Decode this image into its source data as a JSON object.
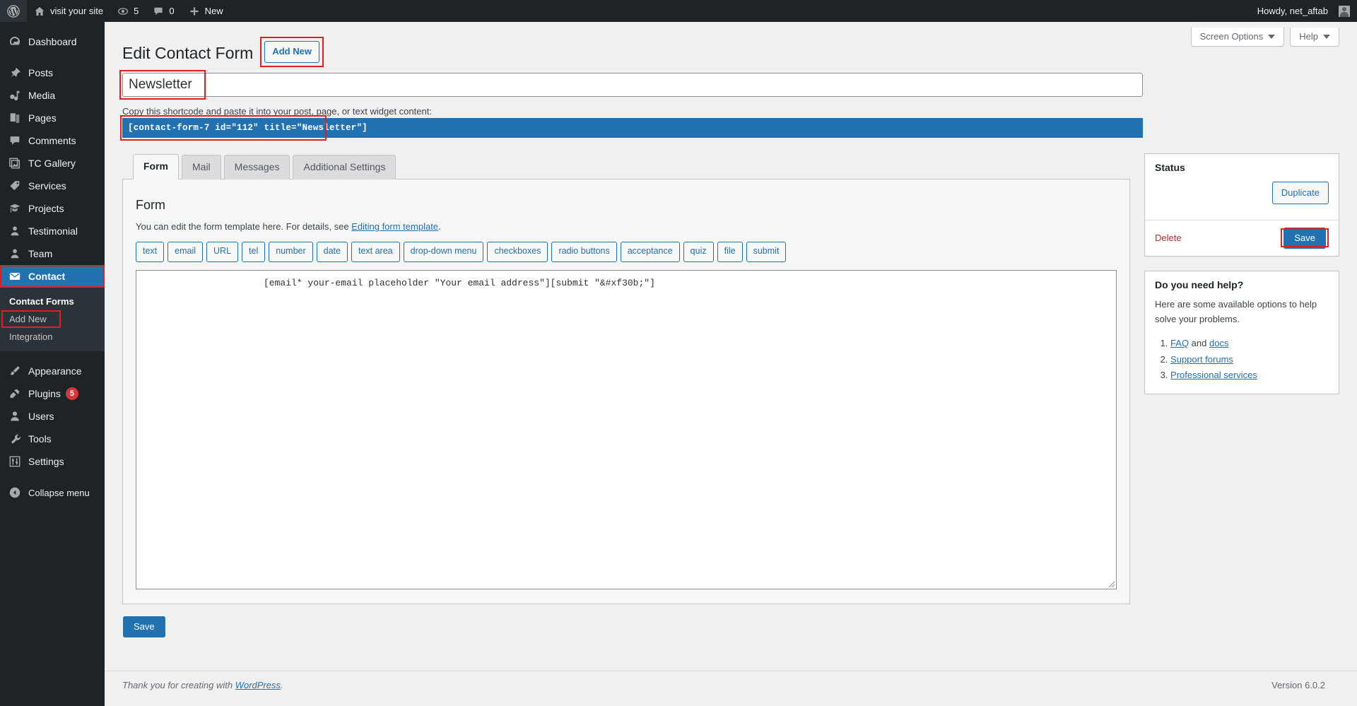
{
  "adminbar": {
    "logo_icon": "wordpress-logo-icon",
    "left_items": [
      {
        "label": "visit your site",
        "icon": "home-icon"
      },
      {
        "label": "5",
        "icon": "updates-icon"
      },
      {
        "label": "0",
        "icon": "comment-icon"
      },
      {
        "label": "New",
        "icon": "plus-icon"
      }
    ],
    "howdy": "Howdy, net_aftab"
  },
  "sidebar": {
    "items": [
      {
        "label": "Dashboard",
        "icon": "dashboard-icon"
      },
      {
        "label": "Posts",
        "icon": "pin-icon"
      },
      {
        "label": "Media",
        "icon": "media-icon"
      },
      {
        "label": "Pages",
        "icon": "pages-icon"
      },
      {
        "label": "Comments",
        "icon": "comment-icon"
      },
      {
        "label": "TC Gallery",
        "icon": "gallery-icon"
      },
      {
        "label": "Services",
        "icon": "tag-icon"
      },
      {
        "label": "Projects",
        "icon": "graduation-cap-icon"
      },
      {
        "label": "Testimonial",
        "icon": "user-icon"
      },
      {
        "label": "Team",
        "icon": "user-icon"
      },
      {
        "label": "Contact",
        "icon": "envelope-icon",
        "current": true
      },
      {
        "label": "Appearance",
        "icon": "brush-icon"
      },
      {
        "label": "Plugins",
        "icon": "plug-icon",
        "badge": "5"
      },
      {
        "label": "Users",
        "icon": "user-icon"
      },
      {
        "label": "Tools",
        "icon": "wrench-icon"
      },
      {
        "label": "Settings",
        "icon": "sliders-icon"
      },
      {
        "label": "Collapse menu",
        "icon": "collapse-arrow-icon"
      }
    ],
    "submenu": {
      "heading": "Contact Forms",
      "items": [
        {
          "label": "Add New",
          "highlighted": true
        },
        {
          "label": "Integration",
          "highlighted": false
        }
      ]
    }
  },
  "screen_meta": {
    "screen_options": "Screen Options",
    "help": "Help"
  },
  "page": {
    "title": "Edit Contact Form",
    "add_new_label": "Add New",
    "form_title_value": "Newsletter",
    "shortcode_label": "Copy this shortcode and paste it into your post, page, or text widget content:",
    "shortcode_value": "[contact-form-7 id=\"112\" title=\"Newsletter\"]"
  },
  "tabs": [
    {
      "label": "Form",
      "active": true
    },
    {
      "label": "Mail",
      "active": false
    },
    {
      "label": "Messages",
      "active": false
    },
    {
      "label": "Additional Settings",
      "active": false
    }
  ],
  "form_panel": {
    "heading": "Form",
    "description_prefix": "You can edit the form template here. For details, see ",
    "description_link": "Editing form template",
    "description_suffix": ".",
    "tag_buttons": [
      "text",
      "email",
      "URL",
      "tel",
      "number",
      "date",
      "text area",
      "drop-down menu",
      "checkboxes",
      "radio buttons",
      "acceptance",
      "quiz",
      "file",
      "submit"
    ],
    "template_value": "[email* your-email placeholder \"Your email address\"][submit \"&#xf30b;\"]",
    "save_label": "Save"
  },
  "status_box": {
    "title": "Status",
    "duplicate_label": "Duplicate",
    "delete_label": "Delete",
    "save_label": "Save"
  },
  "help_box": {
    "title": "Do you need help?",
    "intro": "Here are some available options to help solve your problems.",
    "items": [
      {
        "prefix": "",
        "link1": "FAQ",
        "middle": " and ",
        "link2": "docs",
        "suffix": ""
      },
      {
        "prefix": "",
        "link1": "Support forums",
        "middle": "",
        "link2": "",
        "suffix": ""
      },
      {
        "prefix": "",
        "link1": "Professional services",
        "middle": "",
        "link2": "",
        "suffix": ""
      }
    ]
  },
  "footer": {
    "thanks_prefix": "Thank you for creating with ",
    "thanks_link": "WordPress",
    "thanks_suffix": ".",
    "version": "Version 6.0.2"
  },
  "colors": {
    "accent": "#2271b1",
    "sidebar_bg": "#1d2327",
    "highlight": "#e02020",
    "danger": "#b32d2e"
  }
}
